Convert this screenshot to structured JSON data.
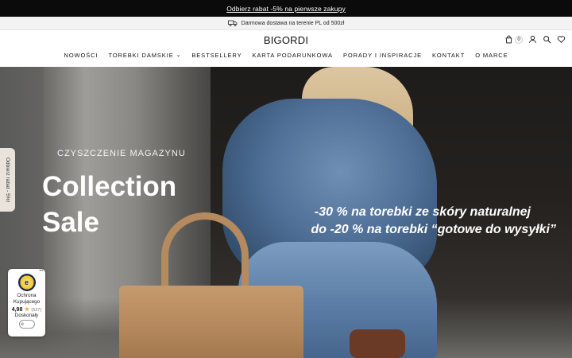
{
  "promo_bar": {
    "text": "Odbierz rabat -5% na pierwsze zakupy"
  },
  "shipping_bar": {
    "text": "Darmowa dostawa na terenie PL od 500zł",
    "icon": "truck-icon"
  },
  "header": {
    "logo": "BIGORDI",
    "cart_count": "0",
    "icons": [
      "cart-icon",
      "user-icon",
      "search-icon",
      "heart-icon"
    ]
  },
  "nav": {
    "items": [
      {
        "label": "NOWOŚCI"
      },
      {
        "label": "TOREBKI DAMSKIE",
        "has_dropdown": true
      },
      {
        "label": "BESTSELLERY"
      },
      {
        "label": "KARTA PODARUNKOWA"
      },
      {
        "label": "PORADY I INSPIRACJE"
      },
      {
        "label": "KONTAKT"
      },
      {
        "label": "O MARCE"
      }
    ]
  },
  "hero": {
    "kicker": "CZYSZCZENIE MAGAZYNU",
    "title_line1": "Collection",
    "title_line2": "Sale",
    "promo_line1": "-30 % na torebki ze skóry naturalnej",
    "promo_line2": "do -20 % na torebki  “gotowe do wysyłki”"
  },
  "side_tab": {
    "text": "Odbierz rabat - 5%!"
  },
  "trust_badge": {
    "more": "•••",
    "seal_letter": "e",
    "label_line1": "Ochrona",
    "label_line2": "Kupującego",
    "rating": "4,98",
    "star": "★",
    "review_count": "(527)",
    "grade": "Doskonały",
    "mini_seal": "e"
  },
  "colors": {
    "top_bar": "#0b0b0b",
    "shipping_bar": "#f3f3f3",
    "side_tab": "#e9e3dc",
    "star": "#f0a22a"
  }
}
